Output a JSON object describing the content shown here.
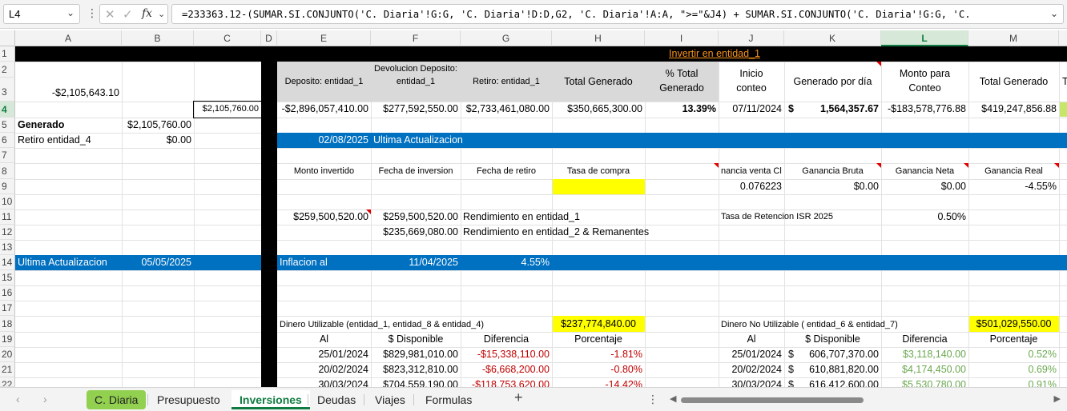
{
  "formula_bar": {
    "name_box": "L4",
    "formula": "=233363.12-(SUMAR.SI.CONJUNTO('C. Diaria'!G:G, 'C. Diaria'!D:D,G2, 'C. Diaria'!A:A, \">=\"&J4) + SUMAR.SI.CONJUNTO('C. Diaria'!G:G, 'C."
  },
  "columns": [
    "A",
    "B",
    "C",
    "D",
    "E",
    "F",
    "G",
    "H",
    "I",
    "J",
    "K",
    "L",
    "M"
  ],
  "rows": [
    "1",
    "2",
    "3",
    "4",
    "5",
    "6",
    "7",
    "8",
    "9",
    "10",
    "11",
    "12",
    "13",
    "14",
    "15",
    "16",
    "17",
    "18",
    "19",
    "20",
    "21",
    "22"
  ],
  "sheet": {
    "r1_link": "Invertir en entidad_1",
    "headers": {
      "e": "Deposito: entidad_1",
      "f": "Devolucion Deposito: entidad_1",
      "g": "Retiro: entidad_1",
      "h": "Total Generado",
      "i": "% Total Generado",
      "j": "Inicio conteo",
      "k": "Generado por día",
      "l": "Monto para Conteo",
      "m": "Total Generado",
      "n": "T"
    },
    "a3": "-$2,105,643.10",
    "row4": {
      "c": "$2,105,760.00",
      "e": "-$2,896,057,410.00",
      "f": "$277,592,550.00",
      "g": "$2,733,461,080.00",
      "h": "$350,665,300.00",
      "i": "13.39%",
      "j": "07/11/2024",
      "k_sym": "$",
      "k": "1,564,357.67",
      "l": "-$183,578,776.88",
      "m": "$419,247,856.88"
    },
    "a5": "Generado",
    "b5": "$2,105,760.00",
    "a6": "Retiro entidad_4",
    "b6": "$0.00",
    "r6_date": "02/08/2025",
    "r6_label": "Ultima Actualizacion",
    "r8": {
      "e": "Monto invertido",
      "f": "Fecha de inversion",
      "g": "Fecha de retiro",
      "h": "Tasa de compra",
      "j": "nancia venta Cl",
      "k": "Ganancia Bruta",
      "l": "Ganancia Neta",
      "m": "Ganancia Real"
    },
    "r9": {
      "j": "0.076223",
      "k": "$0.00",
      "l": "$0.00",
      "m": "-4.55%"
    },
    "r11": {
      "e": "$259,500,520.00",
      "f": "$259,500,520.00",
      "g": "Rendimiento en entidad_1",
      "j": "Tasa de Retencion ISR 2025",
      "l": "0.50%"
    },
    "r12": {
      "f": "$235,669,080.00",
      "g": "Rendimiento en entidad_2 & Remanentes"
    },
    "r14": {
      "a": "Ultima Actualizacion",
      "b": "05/05/2025",
      "e": "Inflacion al",
      "f": "11/04/2025",
      "g": "4.55%"
    },
    "r18": {
      "e": "Dinero Utilizable (entidad_1, entidad_8 & entidad_4)",
      "h": "$237,774,840.00",
      "j": "Dinero No Utilizable ( entidad_6 & entidad_7)",
      "m": "$501,029,550.00"
    },
    "r19": {
      "e": "Al",
      "f": "$ Disponible",
      "g": "Diferencia",
      "h": "Porcentaje",
      "j": "Al",
      "k": "$ Disponible",
      "l": "Diferencia",
      "m": "Porcentaje"
    },
    "data_rows": [
      {
        "e": "25/01/2024",
        "f": "$829,981,010.00",
        "g": "-$15,338,110.00",
        "h": "-1.81%",
        "j": "25/01/2024",
        "k_sym": "$",
        "k": "606,707,370.00",
        "l": "$3,118,140.00",
        "m": "0.52%"
      },
      {
        "e": "20/02/2024",
        "f": "$823,312,810.00",
        "g": "-$6,668,200.00",
        "h": "-0.80%",
        "j": "20/02/2024",
        "k_sym": "$",
        "k": "610,881,820.00",
        "l": "$4,174,450.00",
        "m": "0.69%"
      },
      {
        "e": "30/03/2024",
        "f": "$704,559,190.00",
        "g": "-$118,753,620.00",
        "h": "-14.42%",
        "j": "30/03/2024",
        "k_sym": "$",
        "k": "616,412,600.00",
        "l": "$5,530,780.00",
        "m": "0.91%"
      }
    ]
  },
  "tabs": [
    "C. Diaria",
    "Presupuesto",
    "Inversiones",
    "Deudas",
    "Viajes",
    "Formulas"
  ],
  "active_tab": "Inversiones",
  "colors": {
    "excel_green": "#107c41",
    "header_blue": "#0070c0",
    "highlight_yellow": "#ffff00",
    "tab_green": "#92d050",
    "negative_red": "#c00000",
    "positive_green": "#6aa84f"
  }
}
